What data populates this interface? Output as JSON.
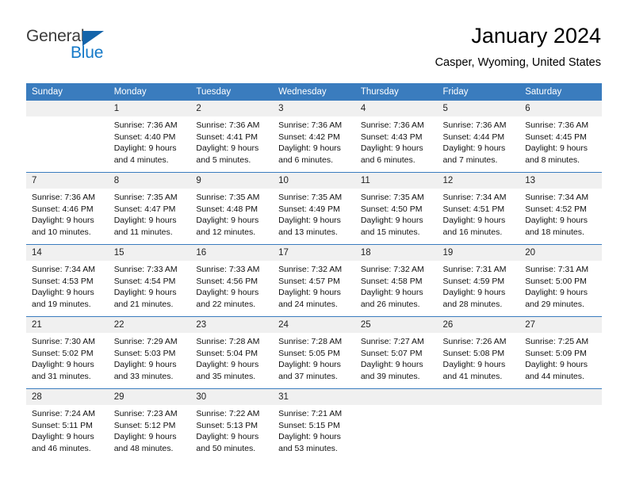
{
  "brand": {
    "word1": "General",
    "word2": "Blue",
    "triangle_color": "#1464aa",
    "blue_color": "#1479c8"
  },
  "header": {
    "title": "January 2024",
    "subtitle": "Casper, Wyoming, United States"
  },
  "theme": {
    "header_row_bg": "#3a7cbe",
    "daynum_bg": "#f0f0f0",
    "page_bg": "#ffffff"
  },
  "weekdays": [
    "Sunday",
    "Monday",
    "Tuesday",
    "Wednesday",
    "Thursday",
    "Friday",
    "Saturday"
  ],
  "labels": {
    "sunrise": "Sunrise:",
    "sunset": "Sunset:",
    "daylight": "Daylight:"
  },
  "weeks": [
    [
      {
        "day": ""
      },
      {
        "day": "1",
        "sunrise": "Sunrise: 7:36 AM",
        "sunset": "Sunset: 4:40 PM",
        "daylight_l1": "Daylight: 9 hours",
        "daylight_l2": "and 4 minutes."
      },
      {
        "day": "2",
        "sunrise": "Sunrise: 7:36 AM",
        "sunset": "Sunset: 4:41 PM",
        "daylight_l1": "Daylight: 9 hours",
        "daylight_l2": "and 5 minutes."
      },
      {
        "day": "3",
        "sunrise": "Sunrise: 7:36 AM",
        "sunset": "Sunset: 4:42 PM",
        "daylight_l1": "Daylight: 9 hours",
        "daylight_l2": "and 6 minutes."
      },
      {
        "day": "4",
        "sunrise": "Sunrise: 7:36 AM",
        "sunset": "Sunset: 4:43 PM",
        "daylight_l1": "Daylight: 9 hours",
        "daylight_l2": "and 6 minutes."
      },
      {
        "day": "5",
        "sunrise": "Sunrise: 7:36 AM",
        "sunset": "Sunset: 4:44 PM",
        "daylight_l1": "Daylight: 9 hours",
        "daylight_l2": "and 7 minutes."
      },
      {
        "day": "6",
        "sunrise": "Sunrise: 7:36 AM",
        "sunset": "Sunset: 4:45 PM",
        "daylight_l1": "Daylight: 9 hours",
        "daylight_l2": "and 8 minutes."
      }
    ],
    [
      {
        "day": "7",
        "sunrise": "Sunrise: 7:36 AM",
        "sunset": "Sunset: 4:46 PM",
        "daylight_l1": "Daylight: 9 hours",
        "daylight_l2": "and 10 minutes."
      },
      {
        "day": "8",
        "sunrise": "Sunrise: 7:35 AM",
        "sunset": "Sunset: 4:47 PM",
        "daylight_l1": "Daylight: 9 hours",
        "daylight_l2": "and 11 minutes."
      },
      {
        "day": "9",
        "sunrise": "Sunrise: 7:35 AM",
        "sunset": "Sunset: 4:48 PM",
        "daylight_l1": "Daylight: 9 hours",
        "daylight_l2": "and 12 minutes."
      },
      {
        "day": "10",
        "sunrise": "Sunrise: 7:35 AM",
        "sunset": "Sunset: 4:49 PM",
        "daylight_l1": "Daylight: 9 hours",
        "daylight_l2": "and 13 minutes."
      },
      {
        "day": "11",
        "sunrise": "Sunrise: 7:35 AM",
        "sunset": "Sunset: 4:50 PM",
        "daylight_l1": "Daylight: 9 hours",
        "daylight_l2": "and 15 minutes."
      },
      {
        "day": "12",
        "sunrise": "Sunrise: 7:34 AM",
        "sunset": "Sunset: 4:51 PM",
        "daylight_l1": "Daylight: 9 hours",
        "daylight_l2": "and 16 minutes."
      },
      {
        "day": "13",
        "sunrise": "Sunrise: 7:34 AM",
        "sunset": "Sunset: 4:52 PM",
        "daylight_l1": "Daylight: 9 hours",
        "daylight_l2": "and 18 minutes."
      }
    ],
    [
      {
        "day": "14",
        "sunrise": "Sunrise: 7:34 AM",
        "sunset": "Sunset: 4:53 PM",
        "daylight_l1": "Daylight: 9 hours",
        "daylight_l2": "and 19 minutes."
      },
      {
        "day": "15",
        "sunrise": "Sunrise: 7:33 AM",
        "sunset": "Sunset: 4:54 PM",
        "daylight_l1": "Daylight: 9 hours",
        "daylight_l2": "and 21 minutes."
      },
      {
        "day": "16",
        "sunrise": "Sunrise: 7:33 AM",
        "sunset": "Sunset: 4:56 PM",
        "daylight_l1": "Daylight: 9 hours",
        "daylight_l2": "and 22 minutes."
      },
      {
        "day": "17",
        "sunrise": "Sunrise: 7:32 AM",
        "sunset": "Sunset: 4:57 PM",
        "daylight_l1": "Daylight: 9 hours",
        "daylight_l2": "and 24 minutes."
      },
      {
        "day": "18",
        "sunrise": "Sunrise: 7:32 AM",
        "sunset": "Sunset: 4:58 PM",
        "daylight_l1": "Daylight: 9 hours",
        "daylight_l2": "and 26 minutes."
      },
      {
        "day": "19",
        "sunrise": "Sunrise: 7:31 AM",
        "sunset": "Sunset: 4:59 PM",
        "daylight_l1": "Daylight: 9 hours",
        "daylight_l2": "and 28 minutes."
      },
      {
        "day": "20",
        "sunrise": "Sunrise: 7:31 AM",
        "sunset": "Sunset: 5:00 PM",
        "daylight_l1": "Daylight: 9 hours",
        "daylight_l2": "and 29 minutes."
      }
    ],
    [
      {
        "day": "21",
        "sunrise": "Sunrise: 7:30 AM",
        "sunset": "Sunset: 5:02 PM",
        "daylight_l1": "Daylight: 9 hours",
        "daylight_l2": "and 31 minutes."
      },
      {
        "day": "22",
        "sunrise": "Sunrise: 7:29 AM",
        "sunset": "Sunset: 5:03 PM",
        "daylight_l1": "Daylight: 9 hours",
        "daylight_l2": "and 33 minutes."
      },
      {
        "day": "23",
        "sunrise": "Sunrise: 7:28 AM",
        "sunset": "Sunset: 5:04 PM",
        "daylight_l1": "Daylight: 9 hours",
        "daylight_l2": "and 35 minutes."
      },
      {
        "day": "24",
        "sunrise": "Sunrise: 7:28 AM",
        "sunset": "Sunset: 5:05 PM",
        "daylight_l1": "Daylight: 9 hours",
        "daylight_l2": "and 37 minutes."
      },
      {
        "day": "25",
        "sunrise": "Sunrise: 7:27 AM",
        "sunset": "Sunset: 5:07 PM",
        "daylight_l1": "Daylight: 9 hours",
        "daylight_l2": "and 39 minutes."
      },
      {
        "day": "26",
        "sunrise": "Sunrise: 7:26 AM",
        "sunset": "Sunset: 5:08 PM",
        "daylight_l1": "Daylight: 9 hours",
        "daylight_l2": "and 41 minutes."
      },
      {
        "day": "27",
        "sunrise": "Sunrise: 7:25 AM",
        "sunset": "Sunset: 5:09 PM",
        "daylight_l1": "Daylight: 9 hours",
        "daylight_l2": "and 44 minutes."
      }
    ],
    [
      {
        "day": "28",
        "sunrise": "Sunrise: 7:24 AM",
        "sunset": "Sunset: 5:11 PM",
        "daylight_l1": "Daylight: 9 hours",
        "daylight_l2": "and 46 minutes."
      },
      {
        "day": "29",
        "sunrise": "Sunrise: 7:23 AM",
        "sunset": "Sunset: 5:12 PM",
        "daylight_l1": "Daylight: 9 hours",
        "daylight_l2": "and 48 minutes."
      },
      {
        "day": "30",
        "sunrise": "Sunrise: 7:22 AM",
        "sunset": "Sunset: 5:13 PM",
        "daylight_l1": "Daylight: 9 hours",
        "daylight_l2": "and 50 minutes."
      },
      {
        "day": "31",
        "sunrise": "Sunrise: 7:21 AM",
        "sunset": "Sunset: 5:15 PM",
        "daylight_l1": "Daylight: 9 hours",
        "daylight_l2": "and 53 minutes."
      },
      {
        "day": ""
      },
      {
        "day": ""
      },
      {
        "day": ""
      }
    ]
  ]
}
